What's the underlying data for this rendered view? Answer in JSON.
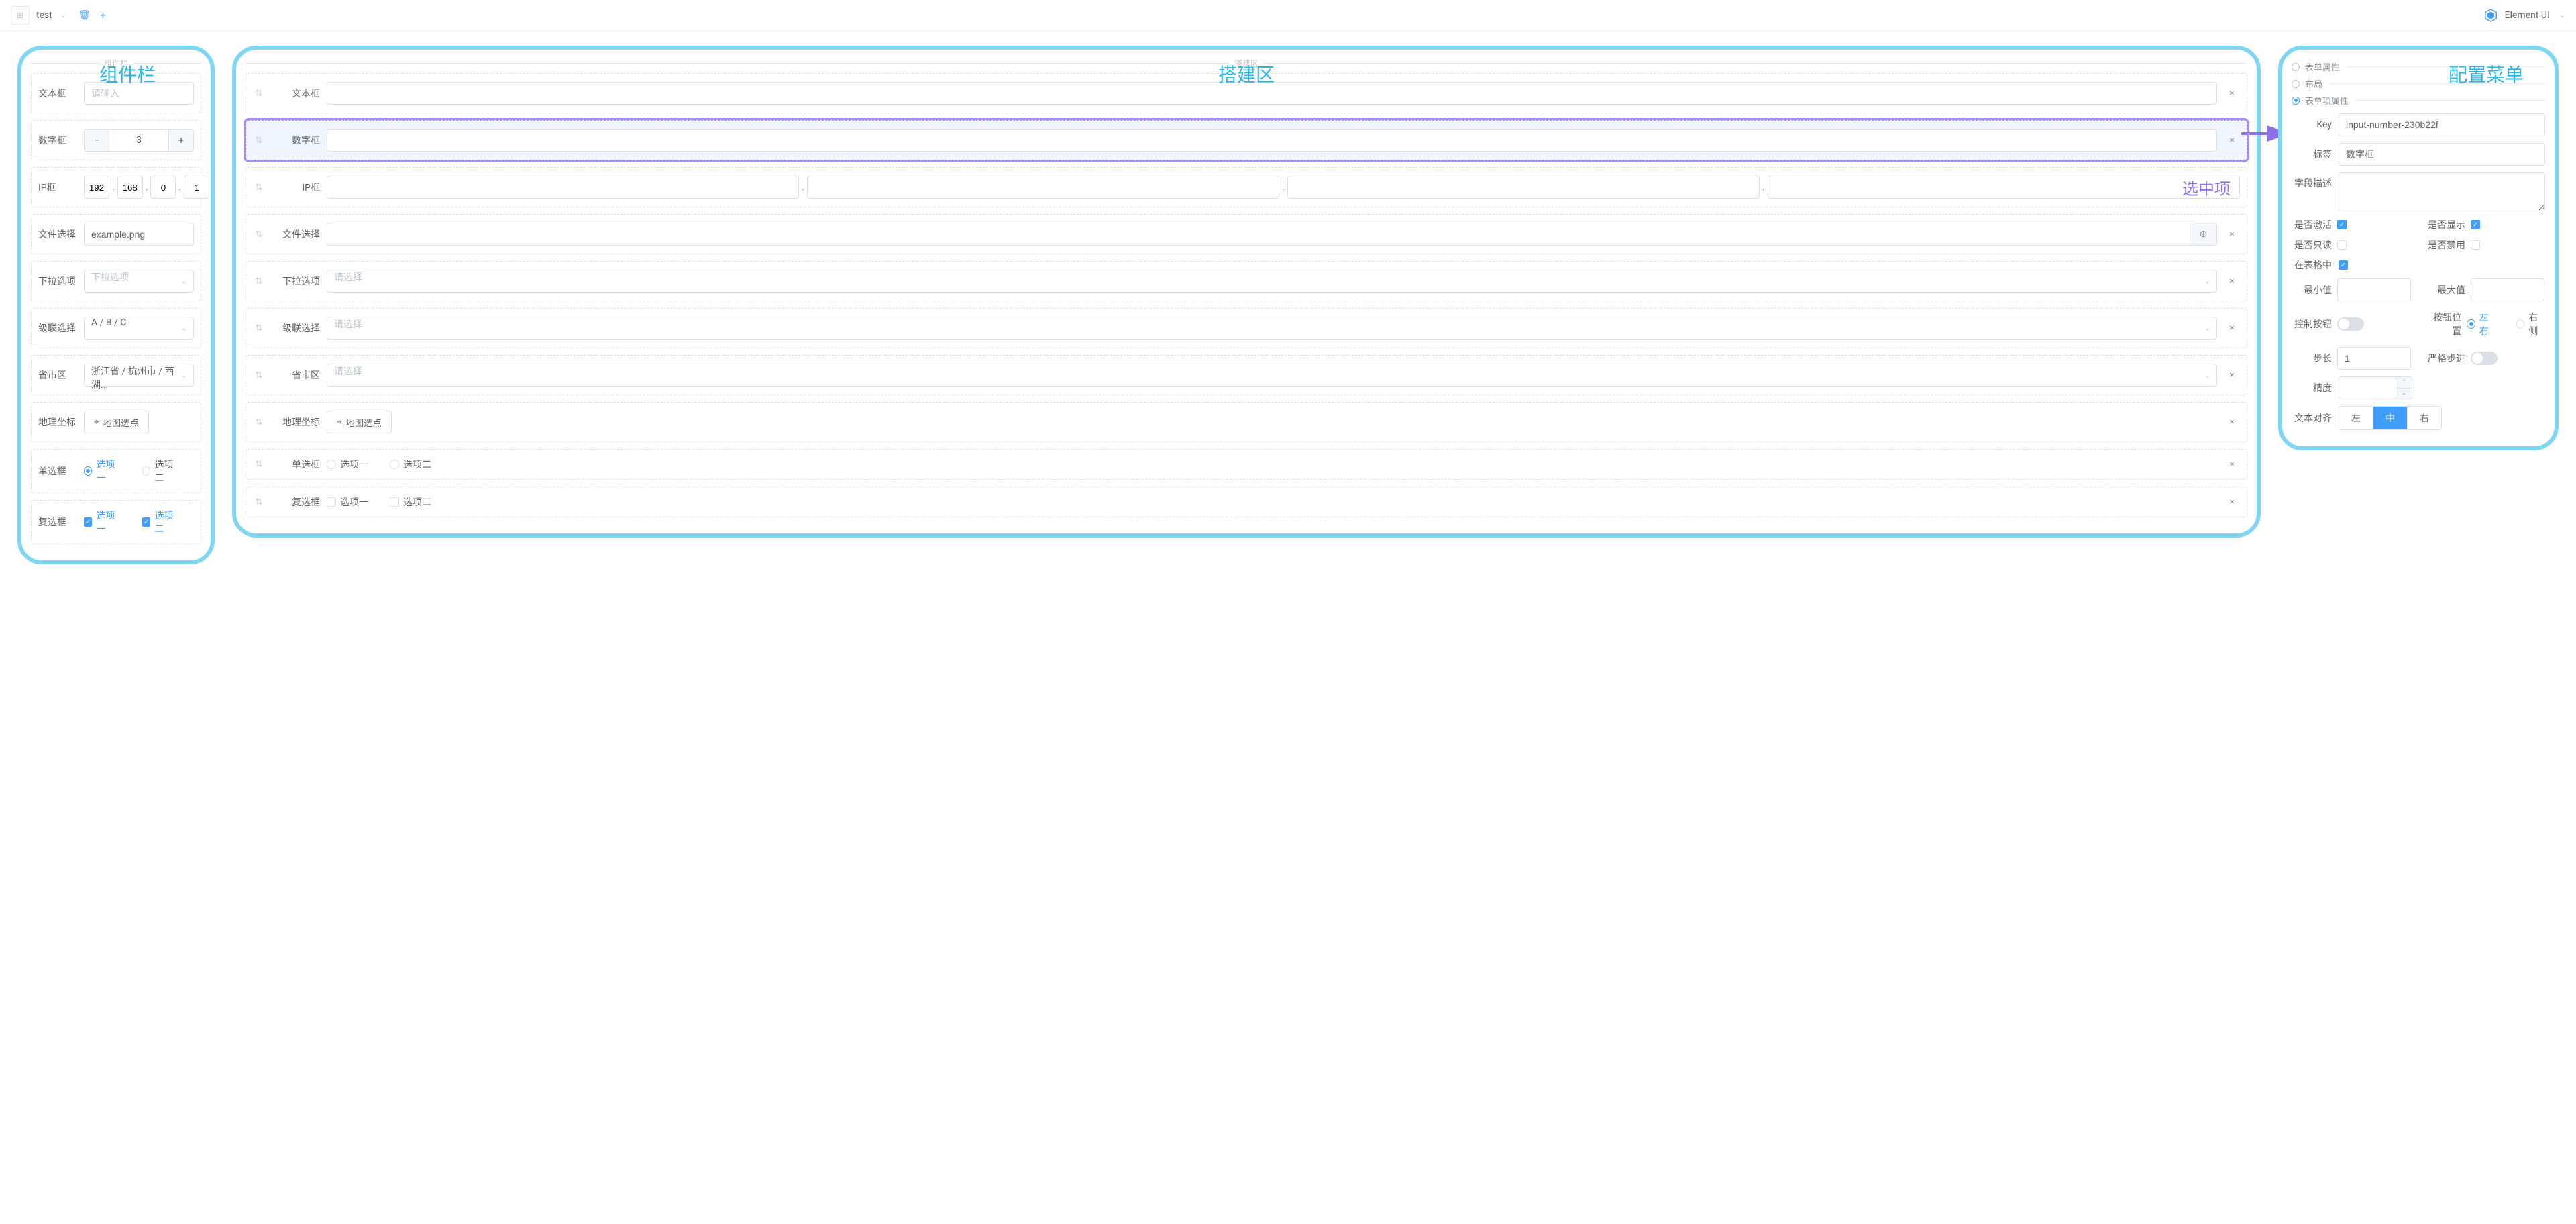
{
  "topbar": {
    "tab": "test",
    "brand": "Element UI"
  },
  "annotations": {
    "componentPanel": "组件栏",
    "buildPanel": "搭建区",
    "configPanel": "配置菜单",
    "selectedItem": "选中项"
  },
  "componentPanel": {
    "heading": "组件栏",
    "items": {
      "text": {
        "label": "文本框",
        "placeholder": "请输入"
      },
      "number": {
        "label": "数字框",
        "value": "3"
      },
      "ip": {
        "label": "IP框",
        "octets": [
          "192",
          "168",
          "0",
          "1"
        ]
      },
      "file": {
        "label": "文件选择",
        "value": "example.png"
      },
      "select": {
        "label": "下拉选项",
        "placeholder": "下拉选项"
      },
      "cascade": {
        "label": "级联选择",
        "value": "A / B / C"
      },
      "region": {
        "label": "省市区",
        "value": "浙江省 / 杭州市 / 西湖..."
      },
      "map": {
        "label": "地理坐标",
        "button": "地图选点"
      },
      "radio": {
        "label": "单选框",
        "opt1": "选项一",
        "opt2": "选项二"
      },
      "check": {
        "label": "复选框",
        "opt1": "选项一",
        "opt2": "选项二"
      }
    }
  },
  "buildPanel": {
    "heading": "搭建区",
    "items": {
      "text": {
        "label": "文本框"
      },
      "number": {
        "label": "数字框"
      },
      "ip": {
        "label": "IP框"
      },
      "file": {
        "label": "文件选择"
      },
      "select": {
        "label": "下拉选项",
        "placeholder": "请选择"
      },
      "cascade": {
        "label": "级联选择",
        "placeholder": "请选择"
      },
      "region": {
        "label": "省市区",
        "placeholder": "请选择"
      },
      "map": {
        "label": "地理坐标",
        "button": "地图选点"
      },
      "radio": {
        "label": "单选框",
        "opt1": "选项一",
        "opt2": "选项二"
      },
      "check": {
        "label": "复选框",
        "opt1": "选项一",
        "opt2": "选项二"
      }
    }
  },
  "configPanel": {
    "sections": {
      "formProps": "表单属性",
      "layout": "布局",
      "itemProps": "表单项属性"
    },
    "fields": {
      "key": {
        "label": "Key",
        "value": "input-number-230b22f"
      },
      "tag": {
        "label": "标签",
        "value": "数字框"
      },
      "desc": {
        "label": "字段描述"
      },
      "active": {
        "label": "是否激活"
      },
      "show": {
        "label": "是否显示"
      },
      "readonly": {
        "label": "是否只读"
      },
      "disabled": {
        "label": "是否禁用"
      },
      "inTable": {
        "label": "在表格中"
      },
      "min": {
        "label": "最小值"
      },
      "max": {
        "label": "最大值"
      },
      "ctrlBtn": {
        "label": "控制按钮"
      },
      "btnPos": {
        "label": "按钮位置",
        "opt1": "左右",
        "opt2": "右侧"
      },
      "step": {
        "label": "步长",
        "value": "1"
      },
      "strict": {
        "label": "严格步进"
      },
      "precision": {
        "label": "精度"
      },
      "textAlign": {
        "label": "文本对齐",
        "left": "左",
        "center": "中",
        "right": "右"
      }
    }
  }
}
